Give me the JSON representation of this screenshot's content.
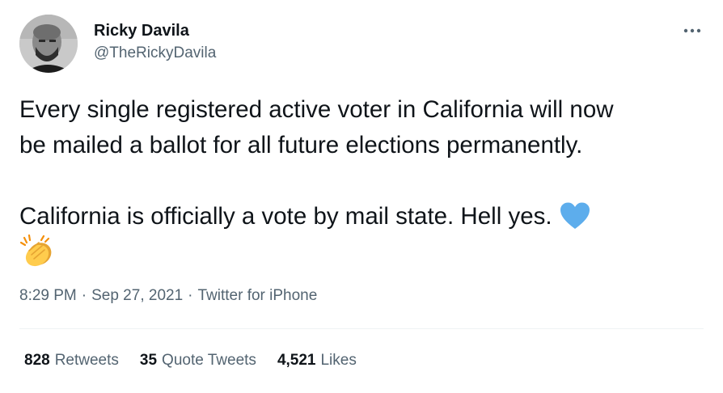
{
  "author": {
    "display_name": "Ricky Davila",
    "handle": "@TheRickyDavila"
  },
  "tweet": {
    "line1": "Every single registered active voter in California will now",
    "line2": "be mailed a ballot for all future elections permanently.",
    "line3": "California is officially a vote by mail state. Hell yes. ",
    "emoji": [
      "blue-heart-icon",
      "clapping-hands-icon"
    ]
  },
  "meta": {
    "time": "8:29 PM",
    "separator": "·",
    "date": "Sep 27, 2021",
    "source": "Twitter for iPhone"
  },
  "stats": {
    "retweets_count": "828",
    "retweets_label": "Retweets",
    "quotes_count": "35",
    "quotes_label": "Quote Tweets",
    "likes_count": "4,521",
    "likes_label": "Likes"
  },
  "colors": {
    "text": "#0f1419",
    "secondary": "#536471",
    "divider": "#eff3f4",
    "heart": "#5dadec",
    "clap": "#f4b943"
  }
}
